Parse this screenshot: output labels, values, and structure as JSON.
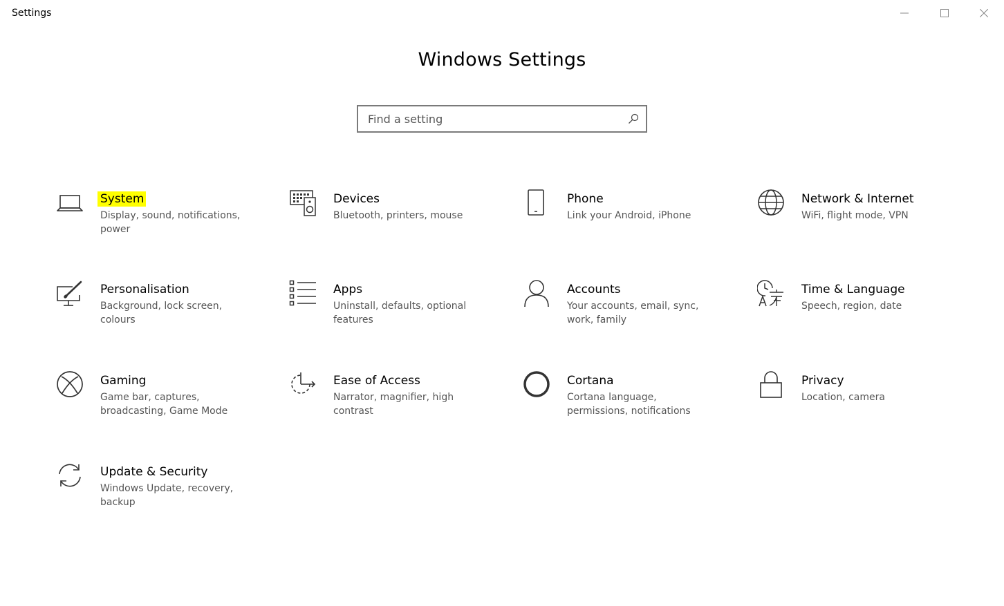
{
  "window": {
    "title": "Settings"
  },
  "page": {
    "title": "Windows Settings"
  },
  "search": {
    "placeholder": "Find a setting",
    "value": ""
  },
  "colors": {
    "highlight": "#ffff00",
    "description": "#555555",
    "icon": "#333333"
  },
  "tiles": [
    {
      "icon": "laptop-icon",
      "title": "System",
      "description": "Display, sound, notifications, power"
    },
    {
      "icon": "keyboard-speaker-icon",
      "title": "Devices",
      "description": "Bluetooth, printers, mouse"
    },
    {
      "icon": "phone-icon",
      "title": "Phone",
      "description": "Link your Android, iPhone"
    },
    {
      "icon": "globe-icon",
      "title": "Network & Internet",
      "description": "WiFi, flight mode, VPN"
    },
    {
      "icon": "paintbrush-monitor-icon",
      "title": "Personalisation",
      "description": "Background, lock screen, colours"
    },
    {
      "icon": "apps-list-icon",
      "title": "Apps",
      "description": "Uninstall, defaults, optional features"
    },
    {
      "icon": "person-icon",
      "title": "Accounts",
      "description": "Your accounts, email, sync, work, family"
    },
    {
      "icon": "clock-language-icon",
      "title": "Time & Language",
      "description": "Speech, region, date"
    },
    {
      "icon": "xbox-icon",
      "title": "Gaming",
      "description": "Game bar, captures, broadcasting, Game Mode"
    },
    {
      "icon": "ease-of-access-icon",
      "title": "Ease of Access",
      "description": "Narrator, magnifier, high contrast"
    },
    {
      "icon": "cortana-circle-icon",
      "title": "Cortana",
      "description": "Cortana language, permissions, notifications"
    },
    {
      "icon": "lock-icon",
      "title": "Privacy",
      "description": "Location, camera"
    },
    {
      "icon": "sync-arrows-icon",
      "title": "Update & Security",
      "description": "Windows Update, recovery, backup"
    }
  ]
}
